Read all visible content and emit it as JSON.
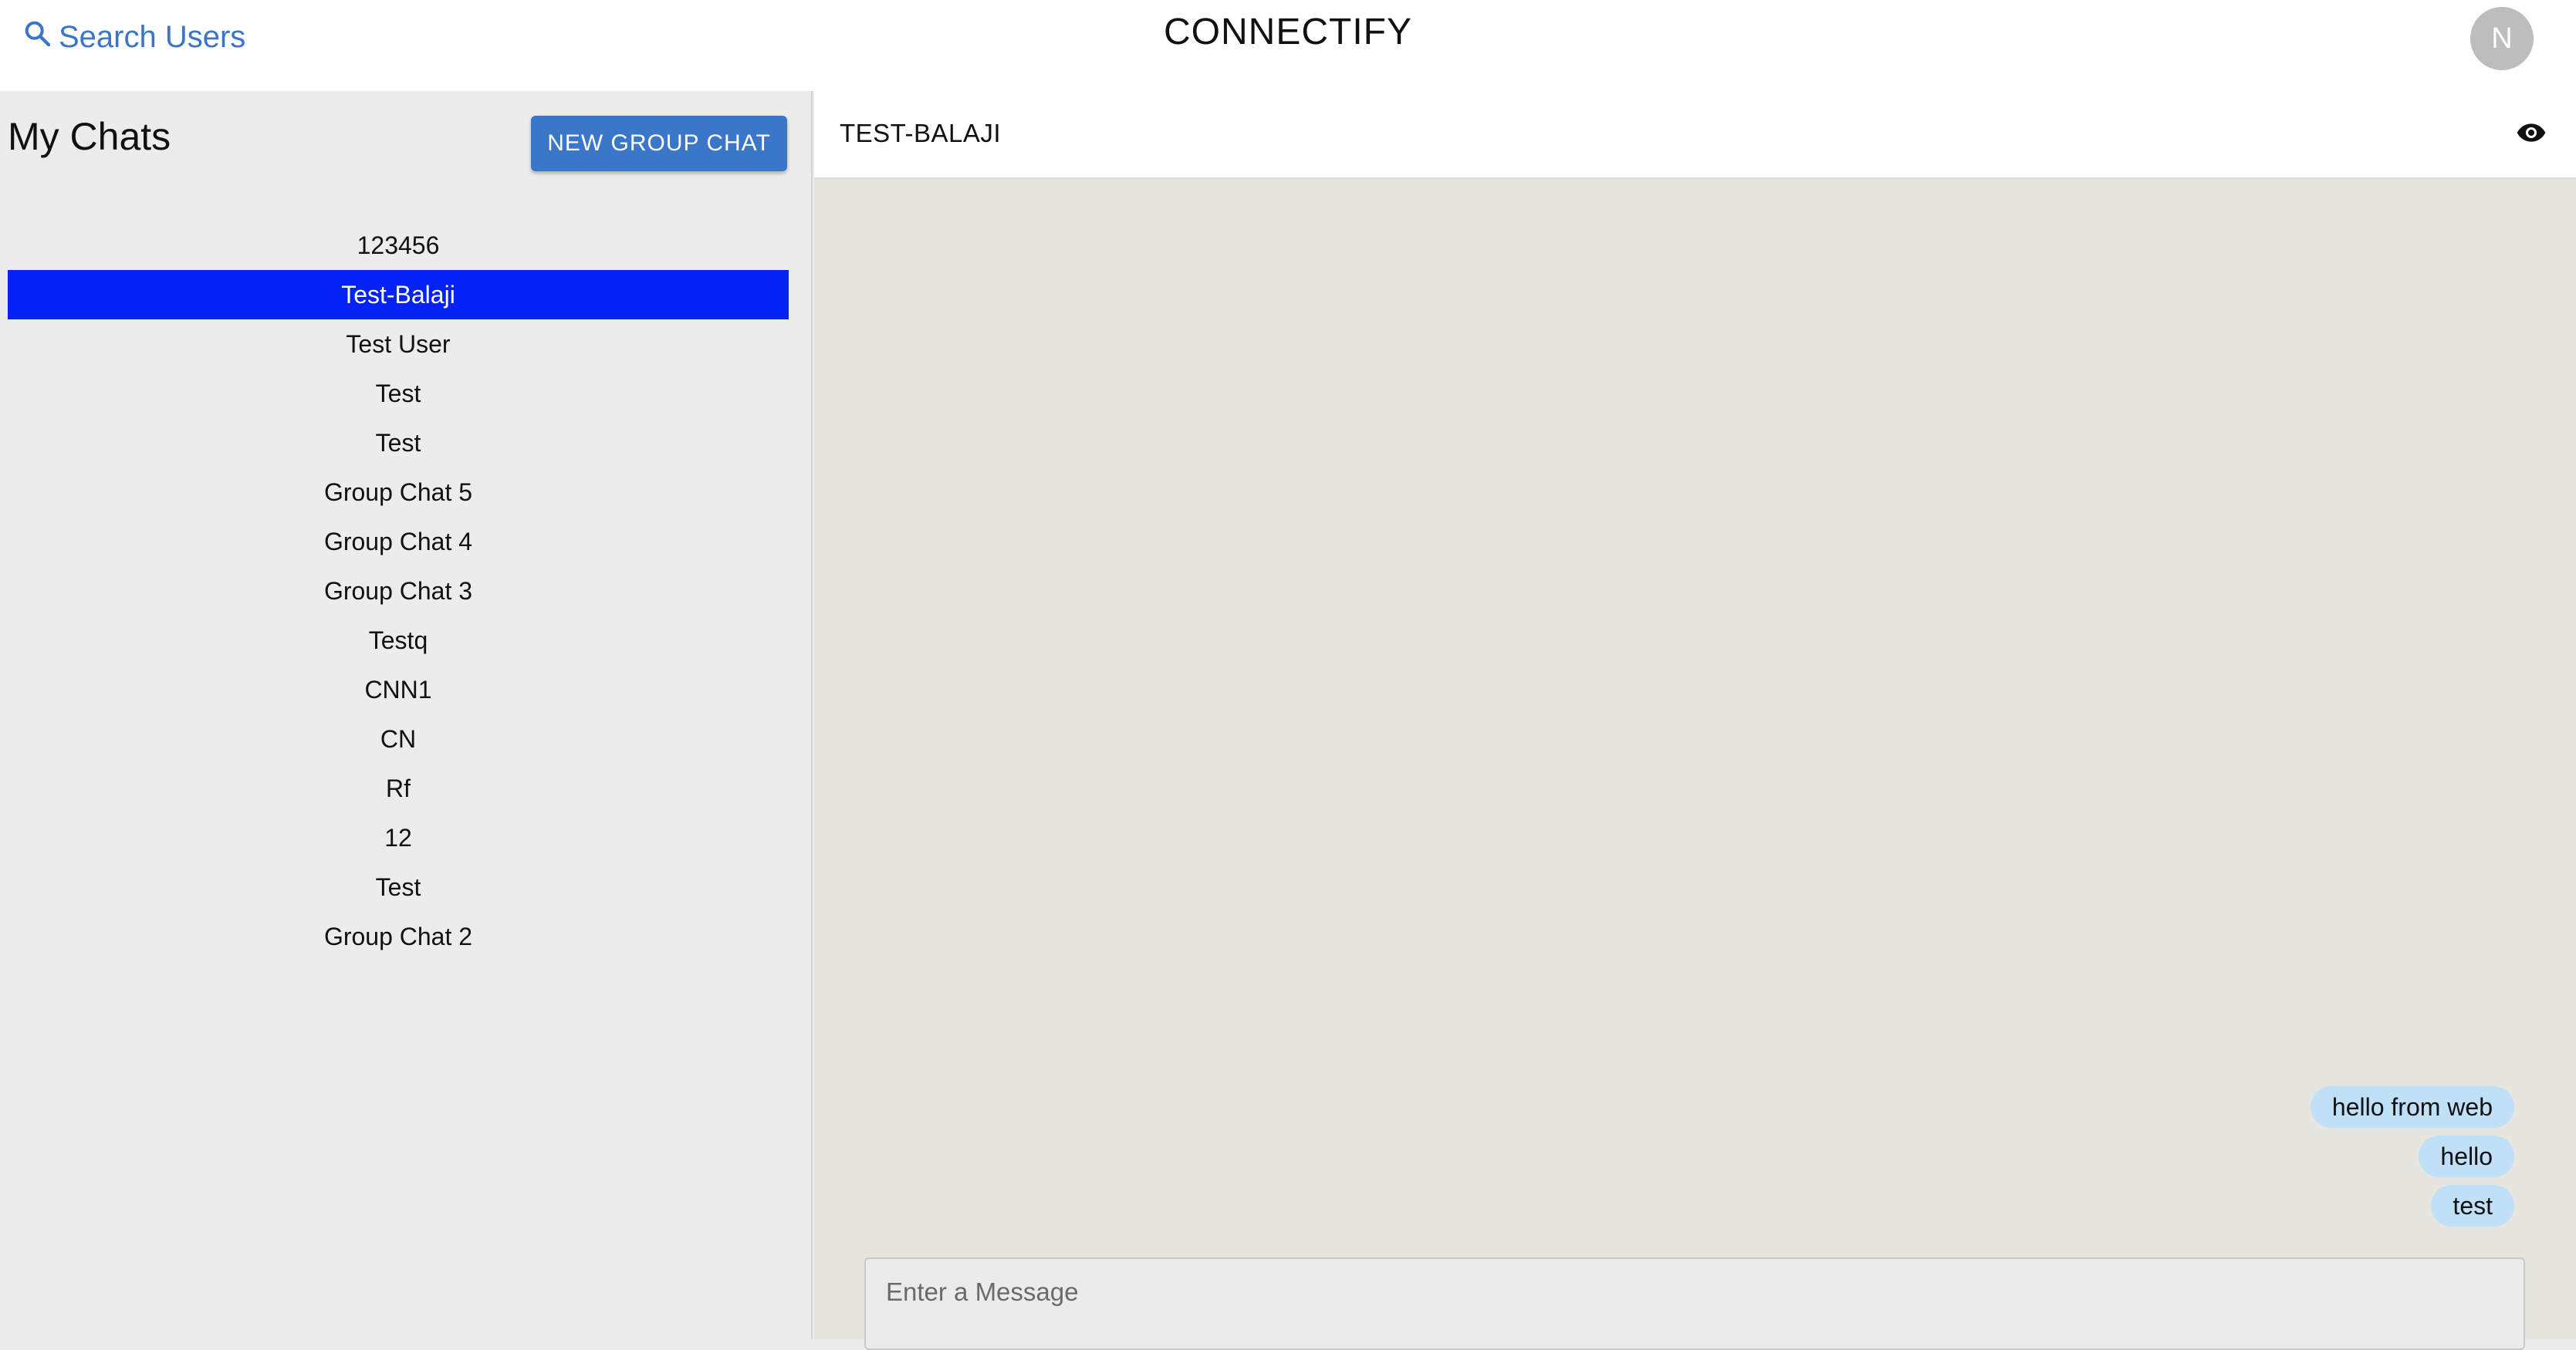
{
  "header": {
    "search_label": "Search Users",
    "app_title": "CONNECTIFY",
    "avatar_initial": "N"
  },
  "sidebar": {
    "title": "My Chats",
    "new_group_label": "NEW GROUP CHAT",
    "chats": [
      {
        "label": "123456",
        "active": false
      },
      {
        "label": "Test-Balaji",
        "active": true
      },
      {
        "label": "Test User",
        "active": false
      },
      {
        "label": "Test",
        "active": false
      },
      {
        "label": "Test",
        "active": false
      },
      {
        "label": "Group Chat 5",
        "active": false
      },
      {
        "label": "Group Chat 4",
        "active": false
      },
      {
        "label": "Group Chat 3",
        "active": false
      },
      {
        "label": "Testq",
        "active": false
      },
      {
        "label": "CNN1",
        "active": false
      },
      {
        "label": "CN",
        "active": false
      },
      {
        "label": "Rf",
        "active": false
      },
      {
        "label": "12",
        "active": false
      },
      {
        "label": "Test",
        "active": false
      },
      {
        "label": "Group Chat 2",
        "active": false
      }
    ]
  },
  "chat": {
    "name": "TEST-BALAJI",
    "view_icon": "eye-icon",
    "messages": [
      "hello from web",
      "hello",
      "test"
    ],
    "input_placeholder": "Enter a Message"
  },
  "colors": {
    "accent": "#3b77c9",
    "active_chat": "#0422f5",
    "bubble": "#bfe0f7",
    "chat_bg": "#e6e5df"
  }
}
